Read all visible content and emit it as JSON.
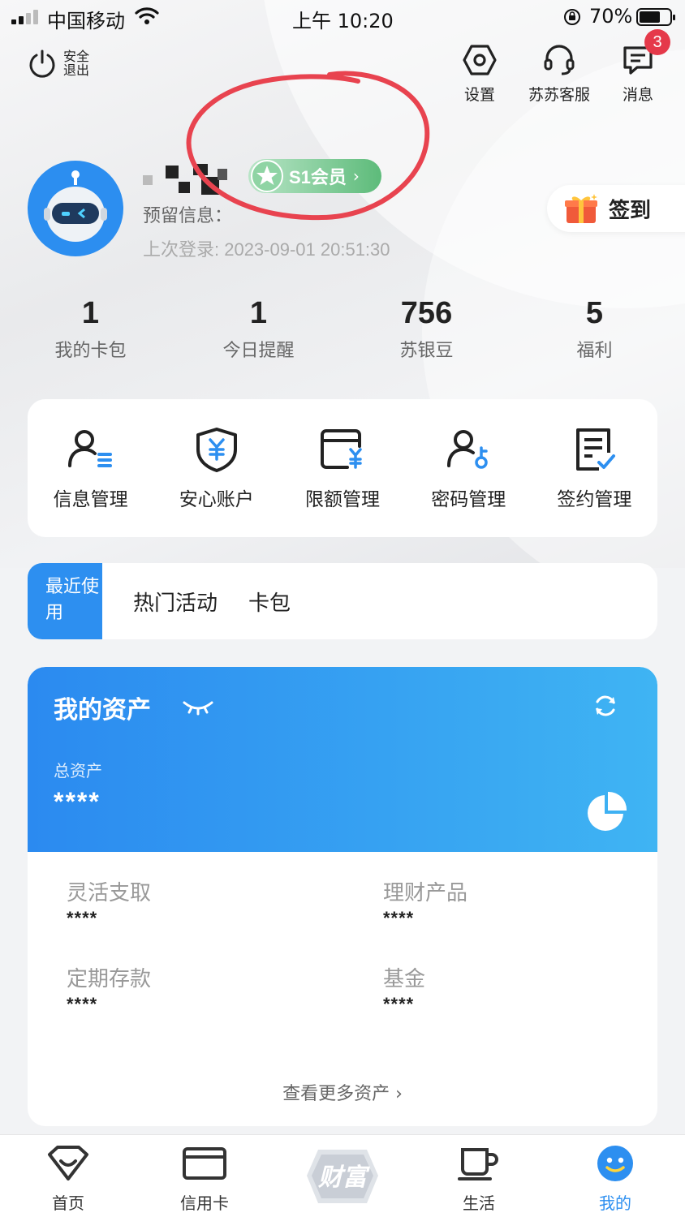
{
  "status_bar": {
    "carrier": "中国移动",
    "time": "上午 10:20",
    "battery": "70%"
  },
  "header": {
    "logout_label": "安全退出",
    "settings_label": "设置",
    "service_label": "苏苏客服",
    "messages_label": "消息",
    "messages_badge": "3"
  },
  "profile": {
    "member_badge": "S1会员",
    "reserve_info": "预留信息：",
    "last_login": "上次登录: 2023-09-01 20:51:30",
    "sign_in": "签到"
  },
  "stats": [
    {
      "value": "1",
      "label": "我的卡包"
    },
    {
      "value": "1",
      "label": "今日提醒"
    },
    {
      "value": "756",
      "label": "苏银豆"
    },
    {
      "value": "5",
      "label": "福利"
    }
  ],
  "quick_actions": [
    {
      "label": "信息管理",
      "icon": "user-info-icon"
    },
    {
      "label": "安心账户",
      "icon": "shield-yuan-icon"
    },
    {
      "label": "限额管理",
      "icon": "wallet-yuan-icon"
    },
    {
      "label": "密码管理",
      "icon": "user-key-icon"
    },
    {
      "label": "签约管理",
      "icon": "contract-check-icon"
    }
  ],
  "tabs": {
    "recent": "最近使用",
    "hot": "热门活动",
    "cards": "卡包"
  },
  "assets": {
    "title": "我的资产",
    "total_label": "总资产",
    "total_value": "****",
    "items": [
      {
        "label": "灵活支取",
        "value": "****"
      },
      {
        "label": "理财产品",
        "value": "****"
      },
      {
        "label": "定期存款",
        "value": "****"
      },
      {
        "label": "基金",
        "value": "****"
      }
    ],
    "more": "查看更多资产 ›"
  },
  "nav": {
    "home": "首页",
    "credit": "信用卡",
    "center": "财富",
    "life": "生活",
    "mine": "我的"
  },
  "colors": {
    "primary": "#2d8ff0",
    "badge_red": "#e5394a",
    "member_green": "#5dbb7a",
    "annotation": "#e8434f"
  }
}
